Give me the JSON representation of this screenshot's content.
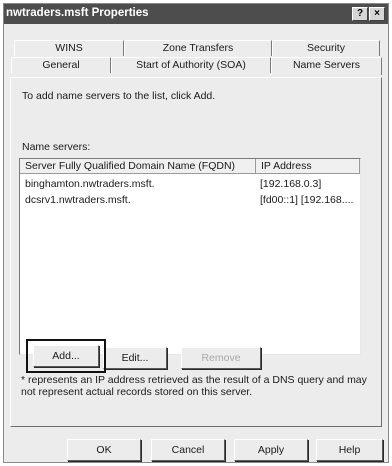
{
  "window": {
    "title": "nwtraders.msft Properties",
    "help_glyph": "?",
    "close_glyph": "×"
  },
  "tabs": {
    "row1": [
      "WINS",
      "Zone Transfers",
      "Security"
    ],
    "row2": [
      "General",
      "Start of Authority (SOA)",
      "Name Servers"
    ],
    "active": "Name Servers"
  },
  "panel": {
    "instruction": "To add name servers to the list, click Add.",
    "list_label": "Name servers:",
    "columns": [
      "Server Fully Qualified Domain Name (FQDN)",
      "IP Address"
    ],
    "rows": [
      {
        "fqdn": "binghamton.nwtraders.msft.",
        "ip": "[192.168.0.3]"
      },
      {
        "fqdn": "dcsrv1.nwtraders.msft.",
        "ip": "[fd00::1] [192.168...."
      }
    ],
    "buttons": {
      "add": "Add...",
      "edit": "Edit...",
      "remove": "Remove"
    },
    "remove_enabled": false,
    "note": "* represents an IP address retrieved as the result of a DNS query and may not represent actual records stored on this server."
  },
  "footer": {
    "ok": "OK",
    "cancel": "Cancel",
    "apply": "Apply",
    "help": "Help"
  }
}
